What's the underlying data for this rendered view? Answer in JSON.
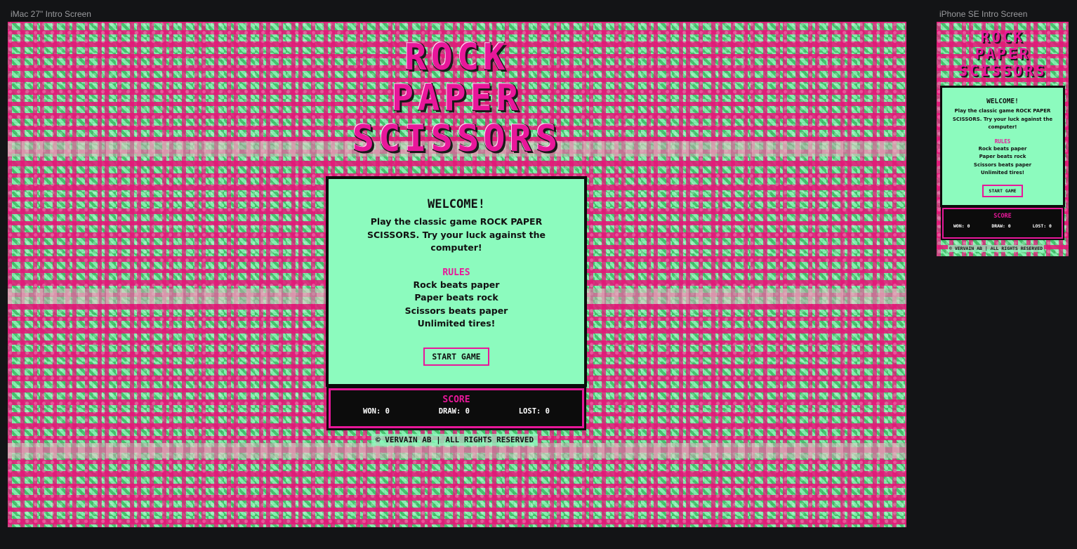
{
  "frames": {
    "desktop_label": "iMac 27\" Intro Screen",
    "mobile_label": "iPhone SE Intro Screen"
  },
  "game": {
    "title_line1": "ROCK",
    "title_line2": "PAPER",
    "title_line3": "SCISSORS",
    "welcome_heading": "WELCOME!",
    "intro_text": "Play the classic game ROCK PAPER SCISSORS. Try your luck against the computer!",
    "rules_heading": "RULES",
    "rules": [
      "Rock beats paper",
      "Paper beats rock",
      "Scissors beats paper",
      "Unlimited tires!"
    ],
    "start_label": "START GAME",
    "score_heading": "SCORE",
    "won_label": "WON: 0",
    "draw_label": "DRAW: 0",
    "lost_label": "LOST: 0",
    "footer": "© VERVAIN AB | ALL RIGHTS RESERVED"
  },
  "colors": {
    "accent_pink": "#e8179a",
    "card_mint": "#8cfbbe",
    "dark": "#0c0c0c",
    "canvas": "#131416"
  }
}
